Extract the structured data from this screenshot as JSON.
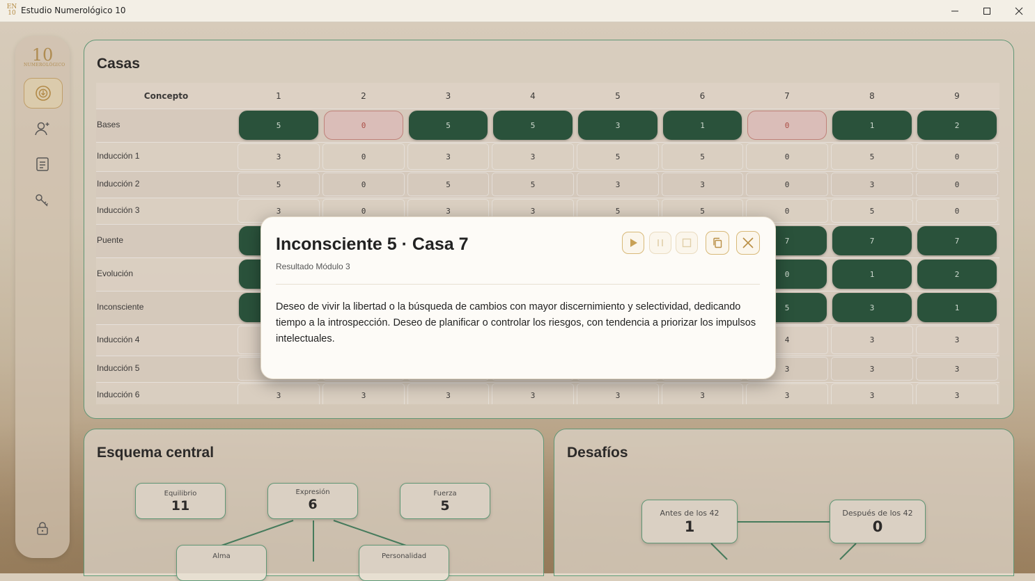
{
  "window": {
    "title": "Estudio Numerológico 10",
    "logo_text": "EN10",
    "icons": [
      "minimize-icon",
      "maximize-icon",
      "close-icon"
    ]
  },
  "sidebar": {
    "logo": {
      "mark": "10",
      "text": "NUMEROLÓGICO"
    },
    "items": [
      {
        "icon": "numerology-circle-icon",
        "active": true
      },
      {
        "icon": "user-add-icon",
        "active": false
      },
      {
        "icon": "document-icon",
        "active": false
      },
      {
        "icon": "key-icon",
        "active": false
      }
    ],
    "bottom_icon": "lock-icon"
  },
  "casas": {
    "title": "Casas",
    "columns": [
      "Concepto",
      "1",
      "2",
      "3",
      "4",
      "5",
      "6",
      "7",
      "8",
      "9"
    ],
    "rows": [
      {
        "label": "Bases",
        "values": [
          "5",
          "0",
          "5",
          "5",
          "3",
          "1",
          "0",
          "1",
          "2"
        ],
        "styles": [
          "g",
          "r",
          "g",
          "g",
          "g",
          "g",
          "r",
          "g",
          "g"
        ]
      },
      {
        "label": "Inducción 1",
        "values": [
          "3",
          "0",
          "3",
          "3",
          "5",
          "5",
          "0",
          "5",
          "0"
        ],
        "styles": [
          "p",
          "p",
          "p",
          "p",
          "p",
          "p",
          "p",
          "p",
          "p"
        ]
      },
      {
        "label": "Inducción 2",
        "values": [
          "5",
          "0",
          "5",
          "5",
          "3",
          "3",
          "0",
          "3",
          "0"
        ],
        "styles": [
          "p",
          "p",
          "p",
          "p",
          "p",
          "p",
          "p",
          "p",
          "p"
        ]
      },
      {
        "label": "Inducción 3",
        "values": [
          "3",
          "0",
          "3",
          "3",
          "5",
          "5",
          "0",
          "5",
          "0"
        ],
        "styles": [
          "p",
          "p",
          "p",
          "p",
          "p",
          "p",
          "p",
          "p",
          "p"
        ]
      },
      {
        "label": "Puente",
        "values": [
          "",
          "",
          "",
          "",
          "",
          "",
          "7",
          "7",
          "7"
        ],
        "styles": [
          "g",
          "g",
          "g",
          "g",
          "g",
          "g",
          "g",
          "g",
          "g"
        ]
      },
      {
        "label": "Evolución",
        "values": [
          "",
          "",
          "",
          "",
          "",
          "",
          "0",
          "1",
          "2"
        ],
        "styles": [
          "g",
          "g",
          "g",
          "g",
          "g",
          "g",
          "g",
          "g",
          "g"
        ]
      },
      {
        "label": "Inconsciente",
        "values": [
          "",
          "",
          "",
          "",
          "",
          "",
          "5",
          "3",
          "1"
        ],
        "styles": [
          "g",
          "g",
          "g",
          "g",
          "g",
          "g",
          "g",
          "g",
          "g"
        ]
      },
      {
        "label": "Inducción 4",
        "values": [
          "",
          "",
          "",
          "",
          "",
          "",
          "4",
          "3",
          "3"
        ],
        "styles": [
          "p",
          "p",
          "p",
          "p",
          "p",
          "p",
          "p",
          "p",
          "p"
        ]
      },
      {
        "label": "Inducción 5",
        "values": [
          "",
          "",
          "",
          "",
          "",
          "",
          "3",
          "3",
          "3"
        ],
        "styles": [
          "p",
          "p",
          "p",
          "p",
          "p",
          "p",
          "p",
          "p",
          "p"
        ]
      },
      {
        "label": "Inducción 6",
        "values": [
          "3",
          "3",
          "3",
          "3",
          "3",
          "3",
          "3",
          "3",
          "3"
        ],
        "styles": [
          "p",
          "p",
          "p",
          "p",
          "p",
          "p",
          "p",
          "p",
          "p"
        ]
      }
    ]
  },
  "esquema": {
    "title": "Esquema central",
    "nodes": [
      {
        "label": "Equilibrio",
        "value": "11"
      },
      {
        "label": "Expresión",
        "value": "6"
      },
      {
        "label": "Fuerza",
        "value": "5"
      },
      {
        "label": "Alma",
        "value": ""
      },
      {
        "label": "Personalidad",
        "value": ""
      }
    ]
  },
  "desafios": {
    "title": "Desafíos",
    "nodes": [
      {
        "label": "Antes de los 42",
        "value": "1"
      },
      {
        "label": "Después de los 42",
        "value": "0"
      }
    ]
  },
  "modal": {
    "title": "Inconsciente 5 · Casa 7",
    "subtitle": "Resultado Módulo 3",
    "body": "Deseo de vivir la libertad o la búsqueda de cambios con mayor discernimiento y selectividad, dedicando tiempo a la introspección. Deseo de planificar o controlar los riesgos, con tendencia a priorizar los impulsos intelectuales.",
    "buttons": [
      "play-icon",
      "pause-icon",
      "stop-icon",
      "copy-icon",
      "close-icon"
    ]
  },
  "colors": {
    "accent_green": "#1f4f36",
    "gold": "#c9a66a",
    "zero_red": "#b24a42"
  }
}
